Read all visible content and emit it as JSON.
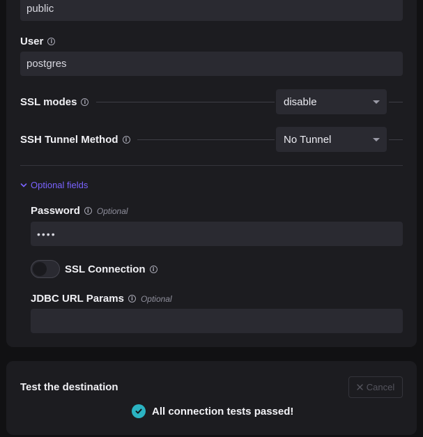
{
  "form": {
    "schema_value": "public",
    "user": {
      "label": "User",
      "value": "postgres"
    },
    "ssl_modes": {
      "label": "SSL modes",
      "selected": "disable"
    },
    "ssh_tunnel": {
      "label": "SSH Tunnel Method",
      "selected": "No Tunnel"
    },
    "optional_toggle_label": "Optional fields",
    "password": {
      "label": "Password",
      "optional": "Optional",
      "value": "••••"
    },
    "ssl_connection": {
      "label": "SSL Connection",
      "enabled": false
    },
    "jdbc": {
      "label": "JDBC URL Params",
      "optional": "Optional",
      "value": ""
    }
  },
  "test": {
    "title": "Test the destination",
    "cancel_label": "Cancel",
    "status_message": "All connection tests passed!"
  },
  "icons": {
    "info": "info-icon",
    "chevron": "chevron-down-icon",
    "caret": "caret-down-icon",
    "close": "close-icon",
    "check": "check-circle-icon"
  },
  "colors": {
    "accent": "#7a63ff",
    "success": "#2bb3c2",
    "card": "#1c1c20",
    "input": "#2a2a31"
  }
}
